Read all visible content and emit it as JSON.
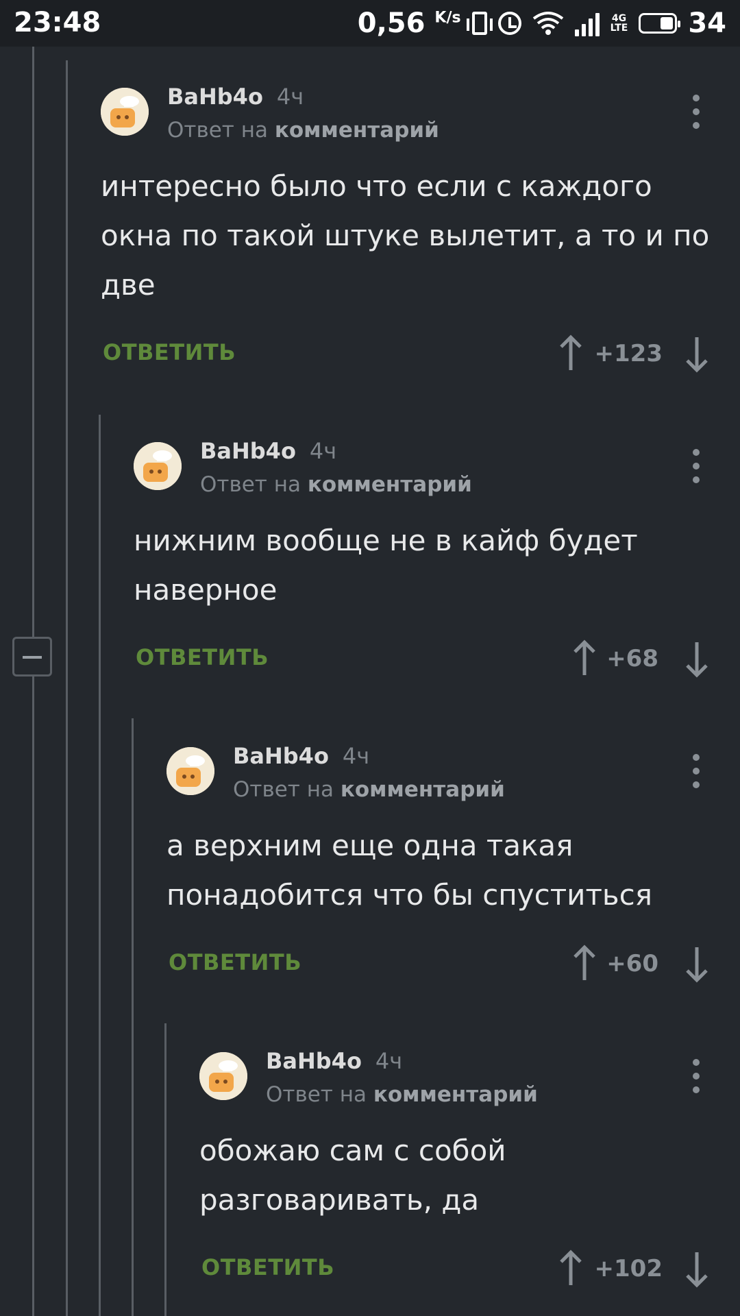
{
  "status_bar": {
    "time": "23:48",
    "speed": "0,56",
    "speed_unit": "K/s",
    "network_type_top": "4G",
    "network_type_bottom": "LTE",
    "battery": "34"
  },
  "comments": [
    {
      "author": "BaHb4o",
      "time": "4ч",
      "reply_prefix": "Ответ на",
      "reply_target": "комментарий",
      "text_lines": [
        "интересно было что если с каждого",
        "окна по такой штуке вылетит, а то и по",
        "две"
      ],
      "reply_label": "ОТВЕТИТЬ",
      "rating": "+123"
    },
    {
      "author": "BaHb4o",
      "time": "4ч",
      "reply_prefix": "Ответ на",
      "reply_target": "комментарий",
      "text_lines": [
        "нижним вообще не в кайф будет",
        "наверное"
      ],
      "reply_label": "ОТВЕТИТЬ",
      "rating": "+68"
    },
    {
      "author": "BaHb4o",
      "time": "4ч",
      "reply_prefix": "Ответ на",
      "reply_target": "комментарий",
      "text_lines": [
        "а верхним еще одна такая",
        "понадобится что бы спуститься"
      ],
      "reply_label": "ОТВЕТИТЬ",
      "rating": "+60"
    },
    {
      "author": "BaHb4o",
      "time": "4ч",
      "reply_prefix": "Ответ на",
      "reply_target": "комментарий",
      "text_lines": [
        "обожаю сам с собой",
        "разговаривать, да"
      ],
      "reply_label": "ОТВЕТИТЬ",
      "rating": "+102"
    }
  ],
  "colors": {
    "background": "#24282d",
    "reply_green": "#5f8a3b",
    "thread_line": "#595e64"
  }
}
